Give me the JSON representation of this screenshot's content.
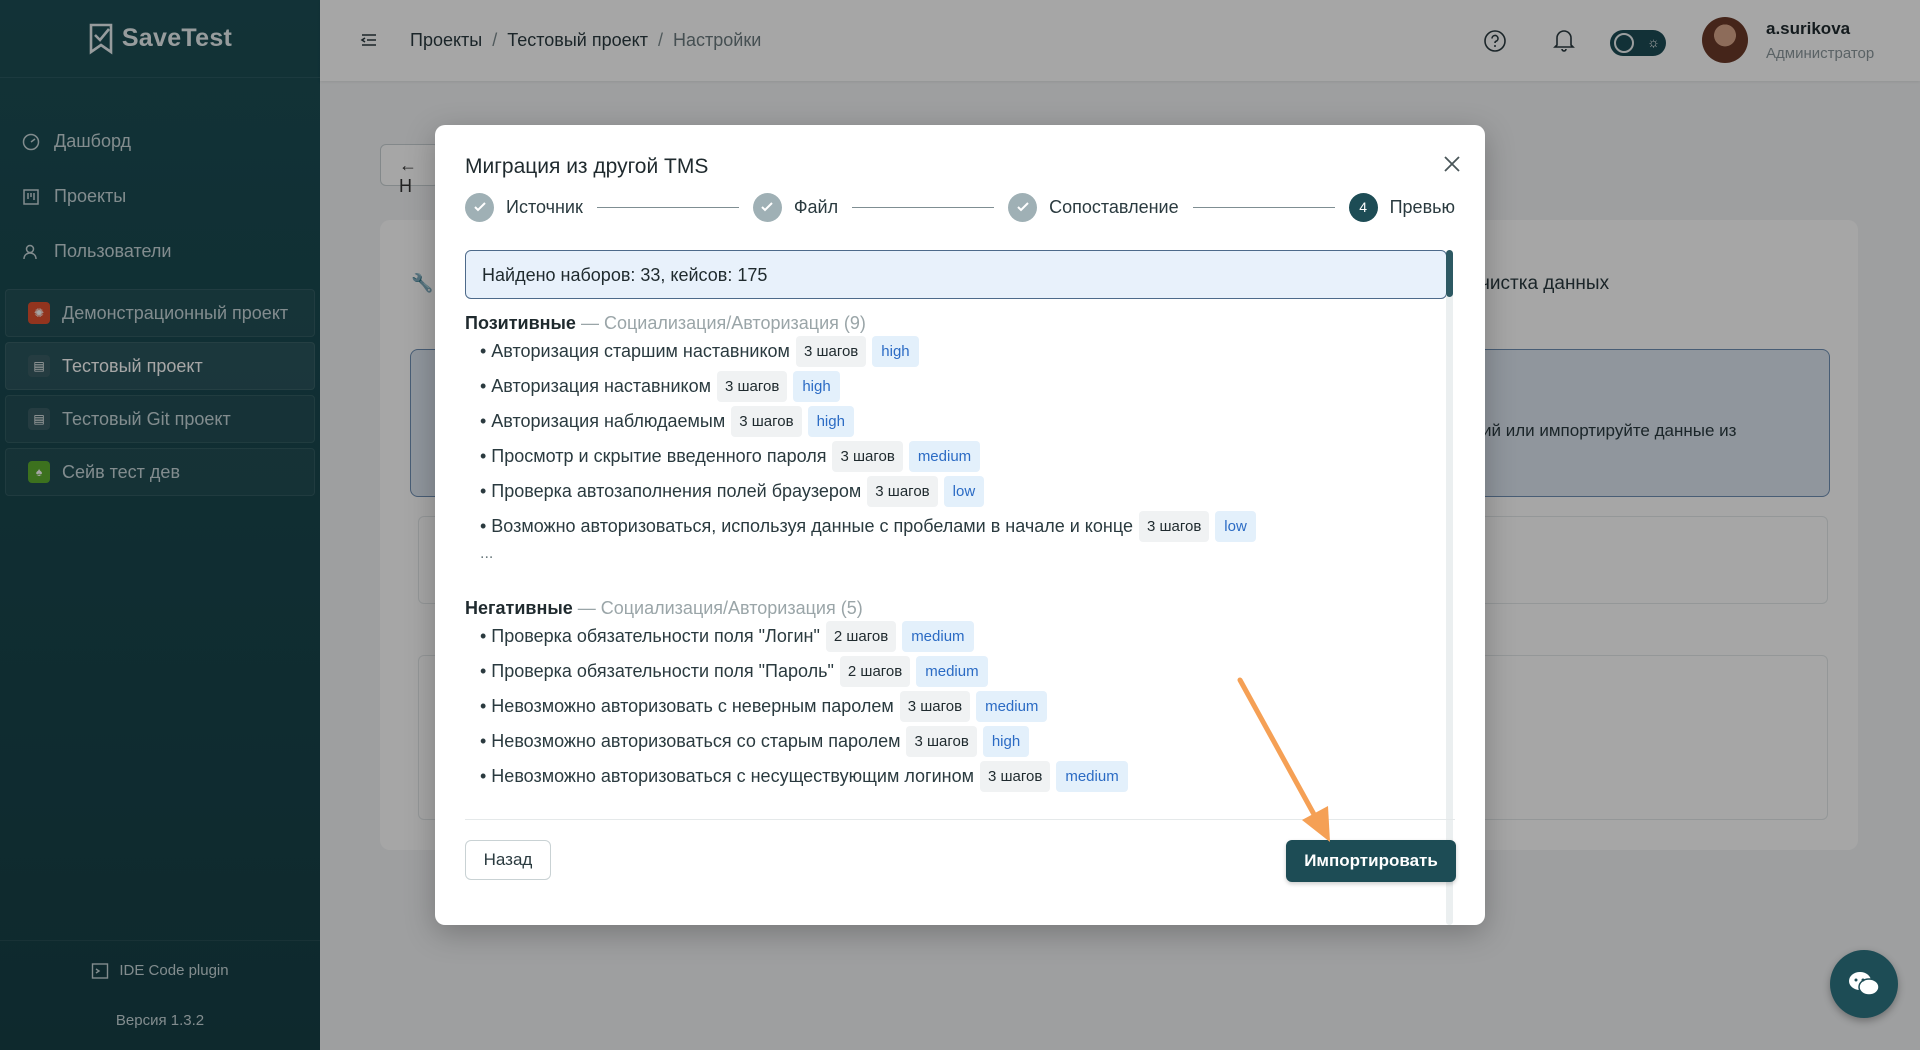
{
  "app": {
    "logo_text": "SaveTest",
    "version": "Версия 1.3.2",
    "plugin_label": "IDE Code plugin"
  },
  "sidebar": {
    "nav": [
      {
        "label": "Дашборд",
        "icon": "dashboard-icon"
      },
      {
        "label": "Проекты",
        "icon": "projects-icon"
      },
      {
        "label": "Пользователи",
        "icon": "users-icon"
      }
    ],
    "projects": [
      {
        "label": "Демонстрационный проект",
        "icon": "bug-icon",
        "color": "#e0512f"
      },
      {
        "label": "Тестовый проект",
        "icon": "document-check-icon",
        "color": "#3a5d64"
      },
      {
        "label": "Тестовый Git проект",
        "icon": "document-check-icon",
        "color": "#3a5d64"
      },
      {
        "label": "Сейв тест дев",
        "icon": "leaf-icon",
        "color": "#5cae2e"
      }
    ]
  },
  "header": {
    "breadcrumbs": [
      "Проекты",
      "Тестовый проект",
      "Настройки"
    ],
    "user": {
      "name": "a.surikova",
      "role": "Администратор"
    }
  },
  "background": {
    "back_label": "Н",
    "tab_label": "чистка данных",
    "info_text": "ий или импортируйте данные из"
  },
  "modal": {
    "title": "Миграция из другой TMS",
    "steps": [
      {
        "label": "Источник",
        "state": "done"
      },
      {
        "label": "Файл",
        "state": "done"
      },
      {
        "label": "Сопоставление",
        "state": "done"
      },
      {
        "label": "Превью",
        "state": "active",
        "number": "4"
      }
    ],
    "found_text": "Найдено наборов: 33, кейсов: 175",
    "sections": [
      {
        "name": "Позитивные",
        "sub": "— Социализация/Авторизация (9)",
        "cases": [
          {
            "title": "• Авторизация старшим наставником",
            "steps": "3 шагов",
            "priority": "high"
          },
          {
            "title": "• Авторизация наставником",
            "steps": "3 шагов",
            "priority": "high"
          },
          {
            "title": "• Авторизация наблюдаемым",
            "steps": "3 шагов",
            "priority": "high"
          },
          {
            "title": "• Просмотр и скрытие введенного пароля",
            "steps": "3 шагов",
            "priority": "medium"
          },
          {
            "title": "• Проверка автозаполнения полей браузером",
            "steps": "3 шагов",
            "priority": "low"
          },
          {
            "title": "• Возможно авторизоваться, используя данные с пробелами в начале и конце",
            "steps": "3 шагов",
            "priority": "low"
          }
        ],
        "more": "..."
      },
      {
        "name": "Негативные",
        "sub": "— Социализация/Авторизация (5)",
        "cases": [
          {
            "title": "• Проверка обязательности поля \"Логин\"",
            "steps": "2 шагов",
            "priority": "medium"
          },
          {
            "title": "• Проверка обязательности поля \"Пароль\"",
            "steps": "2 шагов",
            "priority": "medium"
          },
          {
            "title": "• Невозможно авторизовать с неверным паролем",
            "steps": "3 шагов",
            "priority": "medium"
          },
          {
            "title": "• Невозможно авторизоваться со старым паролем",
            "steps": "3 шагов",
            "priority": "high"
          },
          {
            "title": "• Невозможно авторизоваться с несуществующим логином",
            "steps": "3 шагов",
            "priority": "medium"
          }
        ]
      }
    ],
    "back_button": "Назад",
    "import_button": "Импортировать"
  },
  "colors": {
    "primary": "#1d4c55",
    "sidebar": "#1c4e55",
    "priority_text": "#2b6bc4",
    "priority_bg": "#e3f0fb",
    "annotation_arrow": "#f5a055"
  }
}
